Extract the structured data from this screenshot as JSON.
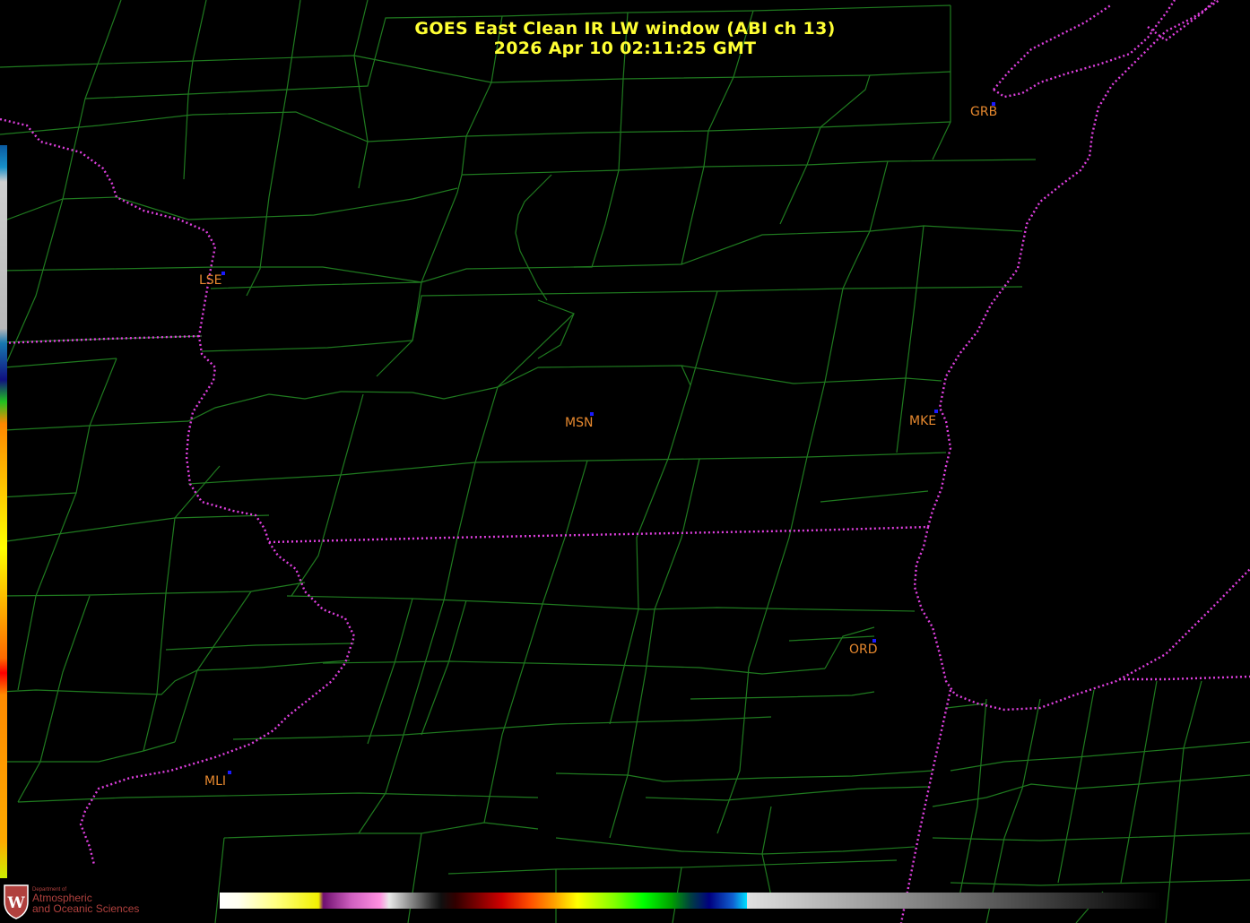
{
  "header": {
    "title": "GOES East Clean IR LW window (ABI ch 13)",
    "timestamp": "2026 Apr 10  02:11:25 GMT"
  },
  "stations": [
    {
      "id": "LSE",
      "label": "LSE"
    },
    {
      "id": "MSN",
      "label": "MSN"
    },
    {
      "id": "MKE",
      "label": "MKE"
    },
    {
      "id": "GRB",
      "label": "GRB"
    },
    {
      "id": "ORD",
      "label": "ORD"
    },
    {
      "id": "MLI",
      "label": "MLI"
    }
  ],
  "logo": {
    "dept": "Department of",
    "line1": "Atmospheric",
    "line2": "and Oceanic Sciences",
    "letter": "W"
  },
  "colors": {
    "title": "#ffff33",
    "county_lines": "#1f7a1f",
    "state_lines": "#e040e0",
    "station_label": "#e6882e",
    "station_marker": "#1a1aff"
  }
}
